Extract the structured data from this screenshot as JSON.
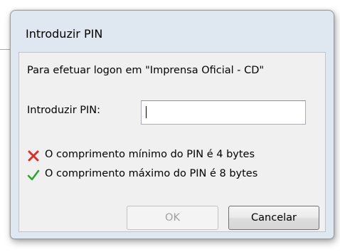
{
  "dialog": {
    "title": "Introduzir PIN",
    "header_text": "Para efetuar logon em \"Imprensa Oficial - CD\"",
    "pin_label": "Introduzir PIN:",
    "pin_value": "",
    "rules": [
      {
        "text": "O comprimento mínimo do PIN é 4 bytes",
        "status": "fail",
        "icon": "red-x-icon"
      },
      {
        "text": "O comprimento máximo do PIN é 8 bytes",
        "status": "pass",
        "icon": "green-check-icon"
      }
    ],
    "buttons": {
      "ok_label": "OK",
      "ok_disabled": true,
      "cancel_label": "Cancelar"
    }
  },
  "colors": {
    "frame": "#dfe8f1",
    "client": "#f0f0f0",
    "fail": "#d9302b",
    "pass": "#2fa52f",
    "disabled_text": "#a0a0a0"
  }
}
